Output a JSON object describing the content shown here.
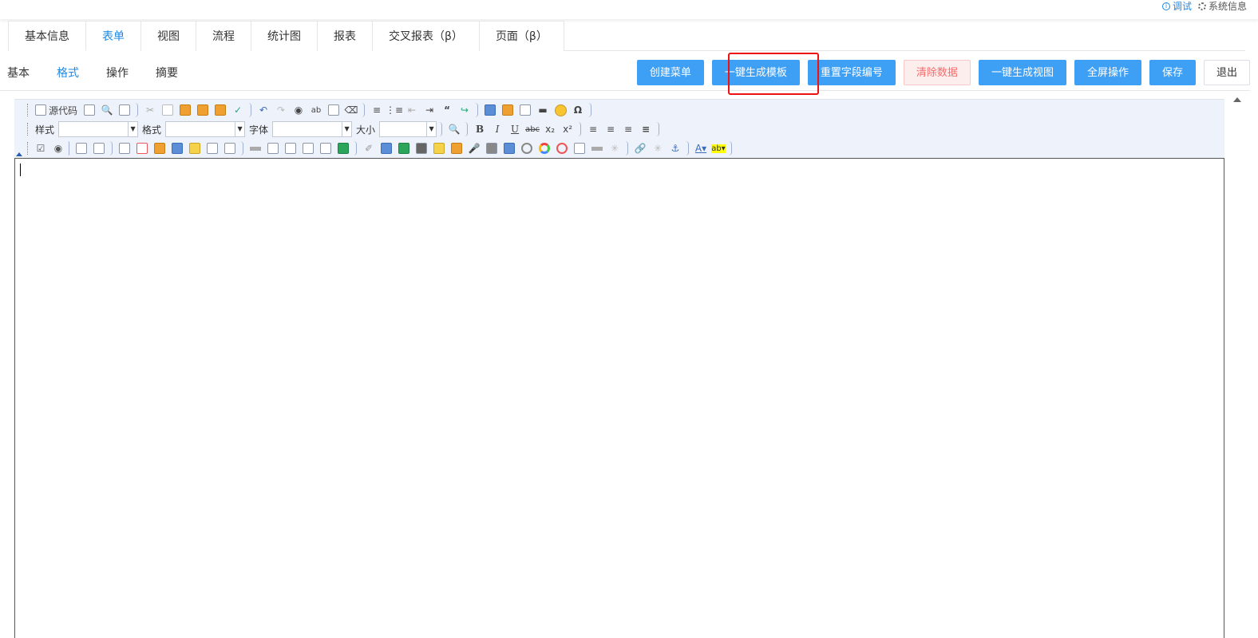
{
  "topbar": {
    "debug_label": "调试",
    "sysinfo_label": "系统信息"
  },
  "main_tabs": [
    {
      "label": "基本信息"
    },
    {
      "label": "表单"
    },
    {
      "label": "视图"
    },
    {
      "label": "流程"
    },
    {
      "label": "统计图"
    },
    {
      "label": "报表"
    },
    {
      "label": "交叉报表（β）"
    },
    {
      "label": "页面（β）"
    }
  ],
  "active_main_tab": "表单",
  "sub_tabs": [
    {
      "label": "基本"
    },
    {
      "label": "格式"
    },
    {
      "label": "操作"
    },
    {
      "label": "摘要"
    }
  ],
  "active_sub_tab": "格式",
  "actions": {
    "create_menu": "创建菜单",
    "gen_template": "一键生成模板",
    "reset_field_numbers": "重置字段编号",
    "clear_data": "清除数据",
    "gen_view": "一键生成视图",
    "fullscreen": "全屏操作",
    "save": "保存",
    "exit": "退出"
  },
  "editor": {
    "toolbar": {
      "source_label": "源代码",
      "style_label": "样式",
      "format_label": "格式",
      "font_label": "字体",
      "size_label": "大小",
      "style_value": "",
      "format_value": "",
      "font_value": "",
      "size_value": ""
    },
    "content_text": ""
  },
  "colors": {
    "primary": "#3ea0f5",
    "danger_bg": "#fdeeee",
    "danger_text": "#f56c6c",
    "active_tab": "#1e88e5",
    "highlight": "#e11111"
  }
}
